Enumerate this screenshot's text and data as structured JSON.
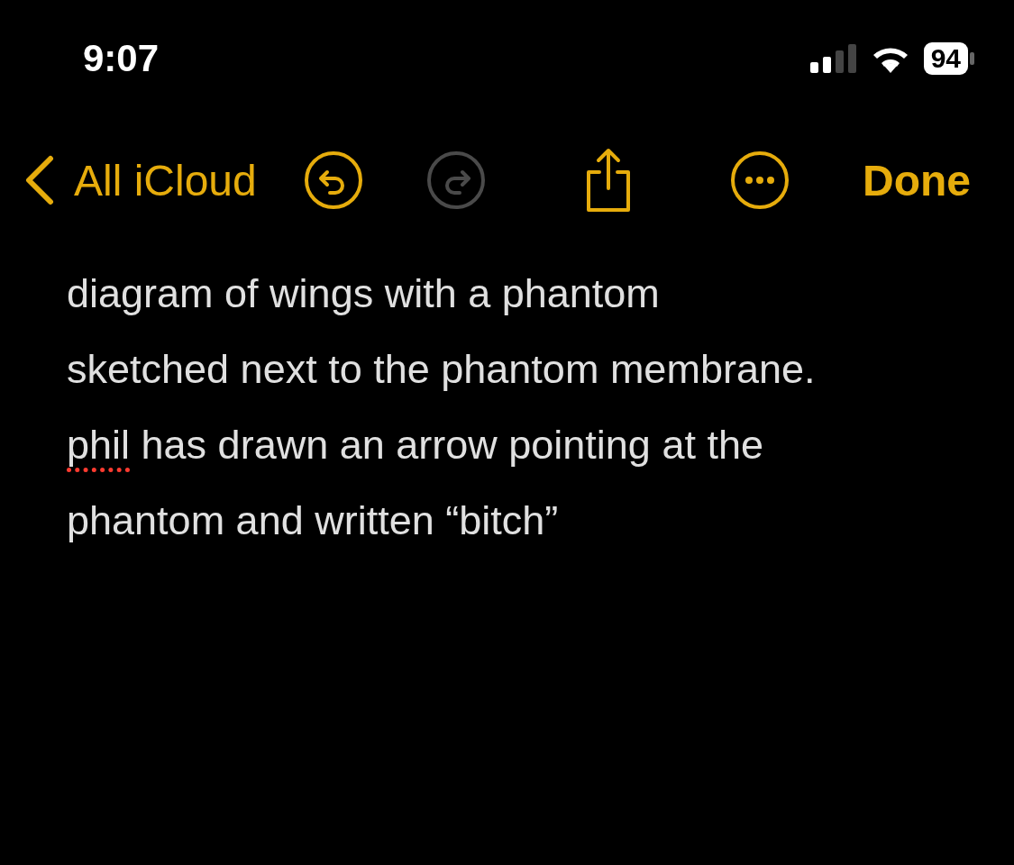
{
  "status_bar": {
    "time": "9:07",
    "battery": "94"
  },
  "toolbar": {
    "back_label": "All iCloud",
    "actions": [
      {
        "kind": "undo",
        "disabled": false
      },
      {
        "kind": "redo",
        "disabled": true
      },
      {
        "kind": "share",
        "disabled": false
      },
      {
        "kind": "more",
        "disabled": false
      }
    ],
    "done_label": "Done"
  },
  "note": {
    "lines": [
      [
        {
          "text": "diagram of wings with a phantom",
          "misspelled": false
        }
      ],
      [
        {
          "text": "sketched next to the phantom membrane.",
          "misspelled": false
        }
      ],
      [
        {
          "text": "phil",
          "misspelled": true
        },
        {
          "text": " has drawn an arrow pointing at the",
          "misspelled": false
        }
      ],
      [
        {
          "text": "phantom and written “bitch”",
          "misspelled": false
        }
      ]
    ]
  }
}
